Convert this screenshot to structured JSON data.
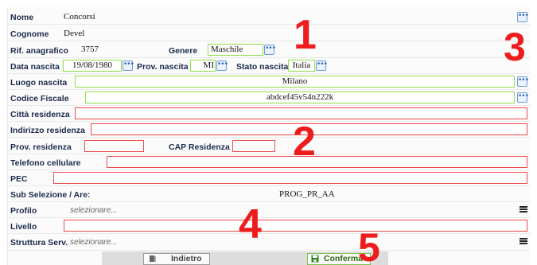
{
  "form": {
    "nome": {
      "label": "Nome",
      "value": "Concorsi"
    },
    "cognome": {
      "label": "Cognome",
      "value": "Devel"
    },
    "rif_anagrafico": {
      "label": "Rif. anagrafico",
      "value": "3757"
    },
    "genere": {
      "label": "Genere",
      "value": "Maschile"
    },
    "data_nascita": {
      "label": "Data nascita",
      "value": "19/08/1980"
    },
    "prov_nascita": {
      "label": "Prov. nascita",
      "value": "MI"
    },
    "stato_nascita": {
      "label": "Stato nascita",
      "value": "Italia"
    },
    "luogo_nascita": {
      "label": "Luogo nascita",
      "value": "Milano"
    },
    "codice_fiscale": {
      "label": "Codice Fiscale",
      "value": "abdcef45v54n222k"
    },
    "citta_residenza": {
      "label": "Città residenza",
      "value": ""
    },
    "indirizzo_residenza": {
      "label": "Indirizzo residenza",
      "value": ""
    },
    "prov_residenza": {
      "label": "Prov. residenza",
      "value": ""
    },
    "cap_residenza": {
      "label": "CAP Residenza",
      "value": ""
    },
    "telefono_cellulare": {
      "label": "Telefono cellulare",
      "value": ""
    },
    "pec": {
      "label": "PEC",
      "value": ""
    },
    "sub_selezione": {
      "label": "Sub Selezione / Are:",
      "value": "PROG_PR_AA"
    },
    "profilo": {
      "label": "Profilo",
      "placeholder": "selezionare..."
    },
    "livello": {
      "label": "Livello",
      "value": ""
    },
    "struttura": {
      "label": "Struttura Serv.",
      "placeholder": "selezionare..."
    }
  },
  "buttons": {
    "back": "Indietro",
    "confirm": "Conferma"
  },
  "annotations": [
    "1",
    "2",
    "3",
    "4",
    "5"
  ],
  "colors": {
    "required_border": "#ef4a4a",
    "valid_border": "#8ee04a",
    "annotation": "#ee1c1c",
    "label": "#1b2a4a"
  },
  "icons": {
    "lookup": "ellipsis-icon",
    "menu": "hamburger-icon",
    "back": "door-icon",
    "confirm": "save-icon"
  }
}
